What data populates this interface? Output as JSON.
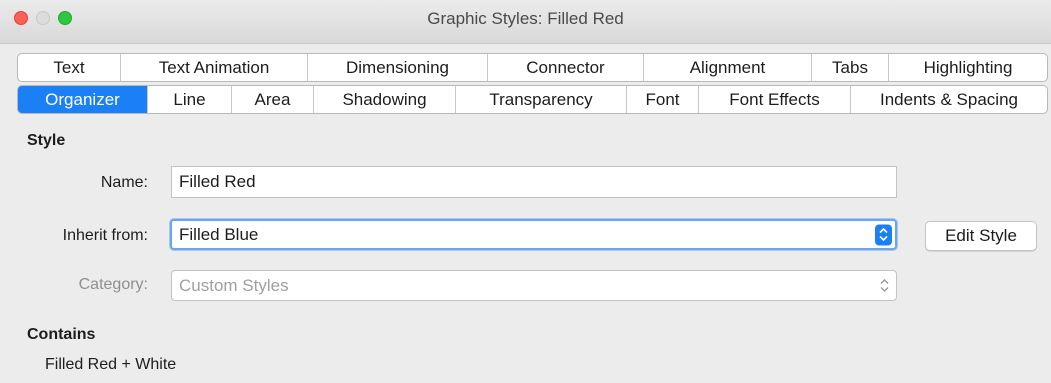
{
  "window": {
    "title": "Graphic Styles: Filled Red"
  },
  "tabs": {
    "row1": [
      "Text",
      "Text Animation",
      "Dimensioning",
      "Connector",
      "Alignment",
      "Tabs",
      "Highlighting"
    ],
    "row2": [
      "Organizer",
      "Line",
      "Area",
      "Shadowing",
      "Transparency",
      "Font",
      "Font Effects",
      "Indents & Spacing"
    ],
    "active": "Organizer"
  },
  "style_section": {
    "heading": "Style",
    "name_label": "Name:",
    "name_value": "Filled Red",
    "inherit_label": "Inherit from:",
    "inherit_value": "Filled Blue",
    "edit_style_button": "Edit Style",
    "category_label": "Category:",
    "category_value": "Custom Styles"
  },
  "contains_section": {
    "heading": "Contains",
    "value": "Filled Red + White"
  },
  "colors": {
    "accent": "#1b7ff6",
    "close": "#fc5f57",
    "maximize": "#2ec840"
  }
}
